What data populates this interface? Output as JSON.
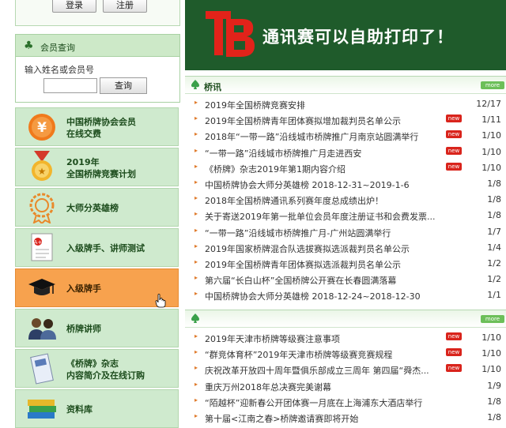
{
  "login": {
    "login_label": "登录",
    "register_label": "注册"
  },
  "member": {
    "heading": "会员查询",
    "prompt": "输入姓名或会员号",
    "input_value": "",
    "search_label": "查询"
  },
  "nav": [
    {
      "line1": "中国桥牌协会会员",
      "line2": "在线交费",
      "icon": "yuan-coin-icon"
    },
    {
      "line1": "2019年",
      "line2": "全国桥牌竞赛计划",
      "icon": "medal-icon"
    },
    {
      "line1": "大师分英雄榜",
      "line2": "",
      "icon": "badge-icon"
    },
    {
      "line1": "入级牌手、讲师测试",
      "line2": "",
      "icon": "exam-paper-icon"
    },
    {
      "line1": "入级牌手",
      "line2": "",
      "icon": "graduation-cap-icon"
    },
    {
      "line1": "桥牌讲师",
      "line2": "",
      "icon": "people-icon"
    },
    {
      "line1": "《桥牌》杂志",
      "line2": "内容简介及在线订购",
      "icon": "magazine-icon"
    },
    {
      "line1": "资料库",
      "line2": "",
      "icon": "books-icon"
    }
  ],
  "banner": {
    "text": "通讯赛可以自助打印了！"
  },
  "news1": {
    "heading": "桥讯",
    "more": "more",
    "items": [
      {
        "title": "2019年全国桥牌竞赛安排",
        "date": "12/17",
        "new": false
      },
      {
        "title": "2019年全国桥牌青年团体赛拟增加裁判员名单公示",
        "date": "1/11",
        "new": true
      },
      {
        "title": "2018年“一带一路”沿线城市桥牌推广月南京站圆满举行",
        "date": "1/10",
        "new": true
      },
      {
        "title": "“一带一路”沿线城市桥牌推广月走进西安",
        "date": "1/10",
        "new": true
      },
      {
        "title": "《桥牌》杂志2019年第1期内容介绍",
        "date": "1/10",
        "new": true
      },
      {
        "title": "中国桥牌协会大师分英雄榜 2018-12-31~2019-1-6",
        "date": "1/8",
        "new": false
      },
      {
        "title": "2018年全国桥牌通讯系列赛年度总成绩出炉！",
        "date": "1/8",
        "new": false
      },
      {
        "title": "关于寄送2019年第一批单位会员年度注册证书和会费发票...",
        "date": "1/8",
        "new": false
      },
      {
        "title": "“一带一路”沿线城市桥牌推广月-广州站圆满举行",
        "date": "1/7",
        "new": false
      },
      {
        "title": "2019年国家桥牌混合队选拔赛拟选派裁判员名单公示",
        "date": "1/4",
        "new": false
      },
      {
        "title": "2019年全国桥牌青年团体赛拟选派裁判员名单公示",
        "date": "1/2",
        "new": false
      },
      {
        "title": "第六届“长白山杯”全国桥牌公开赛在长春圆满落幕",
        "date": "1/2",
        "new": false
      },
      {
        "title": "中国桥牌协会大师分英雄榜 2018-12-24~2018-12-30",
        "date": "1/1",
        "new": false
      }
    ]
  },
  "news2": {
    "heading": "",
    "more": "more",
    "items": [
      {
        "title": "2019年天津市桥牌等级赛注意事项",
        "date": "1/10",
        "new": true
      },
      {
        "title": "“群竞体育杯”2019年天津市桥牌等级赛竞赛规程",
        "date": "1/10",
        "new": true
      },
      {
        "title": "庆祝改革开放四十周年暨俱乐部成立三周年 第四届“舜杰...",
        "date": "1/10",
        "new": true
      },
      {
        "title": "重庆万州2018年总决赛完美谢幕",
        "date": "1/9",
        "new": false
      },
      {
        "title": "“陌越杯”迎新春公开团体赛一月底在上海浦东大酒店举行",
        "date": "1/8",
        "new": false
      },
      {
        "title": "第十届<江南之春>桥牌邀请赛即将开始",
        "date": "1/8",
        "new": false
      }
    ]
  },
  "new_badge": "new",
  "colors": {
    "accent_green": "#1f5b2b",
    "nav_bg": "#cfeace",
    "nav_active": "#f7a24e",
    "new_badge": "#d9241c",
    "arrow": "#e07a2b"
  }
}
